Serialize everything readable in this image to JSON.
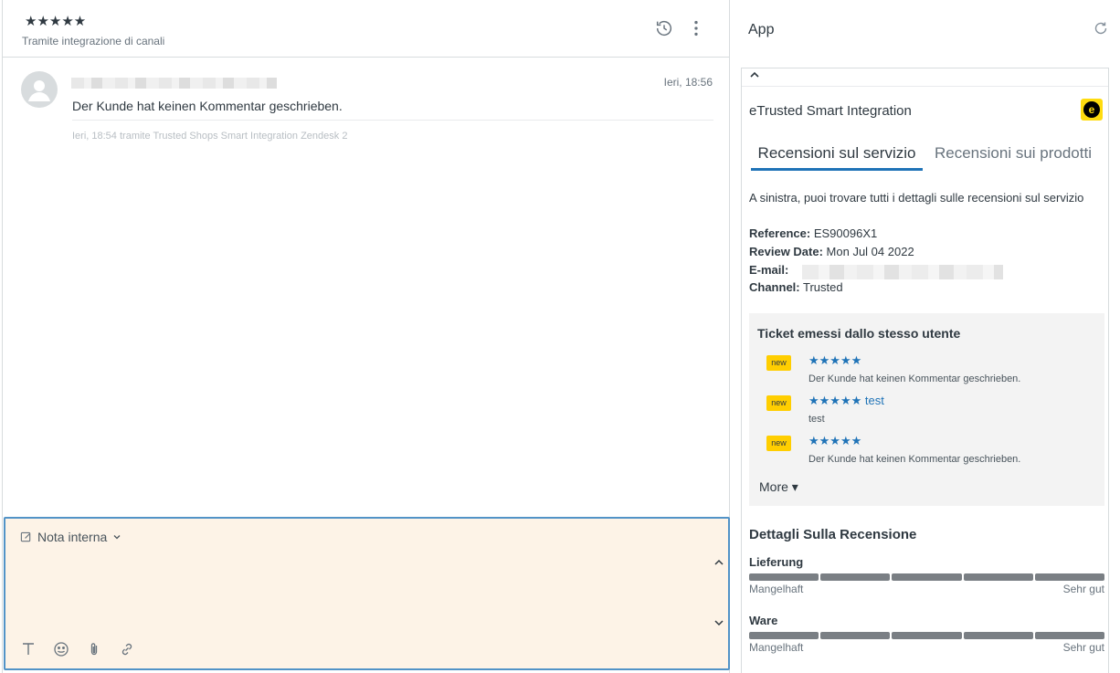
{
  "ticket": {
    "stars": "★★★★★",
    "via": "Tramite integrazione di canali"
  },
  "message": {
    "time": "Ieri, 18:56",
    "body": "Der Kunde hat keinen Kommentar geschrieben.",
    "meta": "Ieri, 18:54 tramite Trusted Shops Smart Integration Zendesk 2"
  },
  "composer": {
    "mode_label": "Nota interna",
    "background": "#fdf3e7",
    "border": "#5293c7"
  },
  "app": {
    "title": "App",
    "integration_title": "eTrusted Smart Integration",
    "logo_letter": "e",
    "tabs": [
      {
        "label": "Recensioni sul servizio",
        "active": true
      },
      {
        "label": "Recensioni sui prodotti",
        "active": false
      }
    ],
    "description": "A sinistra, puoi trovare tutti i dettagli sulle recensioni sul servizio",
    "fields": [
      {
        "key": "Reference:",
        "value": "ES90096X1"
      },
      {
        "key": "Review Date:",
        "value": "Mon Jul 04 2022"
      },
      {
        "key": "E-mail:",
        "value": ""
      },
      {
        "key": "Channel:",
        "value": "Trusted"
      }
    ],
    "same_user": {
      "title": "Ticket emessi dallo stesso utente",
      "items": [
        {
          "badge": "new",
          "link": "★★★★★",
          "text": "Der Kunde hat keinen Kommentar geschrieben."
        },
        {
          "badge": "new",
          "link": "★★★★★ test",
          "text": "test"
        },
        {
          "badge": "new",
          "link": "★★★★★",
          "text": "Der Kunde hat keinen Kommentar geschrieben."
        }
      ],
      "more_label": "More ▾"
    },
    "details": {
      "title": "Dettagli Sulla Recensione",
      "ratings": [
        {
          "label": "Lieferung",
          "min": "Mangelhaft",
          "max": "Sehr gut",
          "level": 5,
          "scale": 5
        },
        {
          "label": "Ware",
          "min": "Mangelhaft",
          "max": "Sehr gut",
          "level": 5,
          "scale": 5
        }
      ]
    },
    "accent": "#1f73b7",
    "badge_color": "#ffce00"
  }
}
